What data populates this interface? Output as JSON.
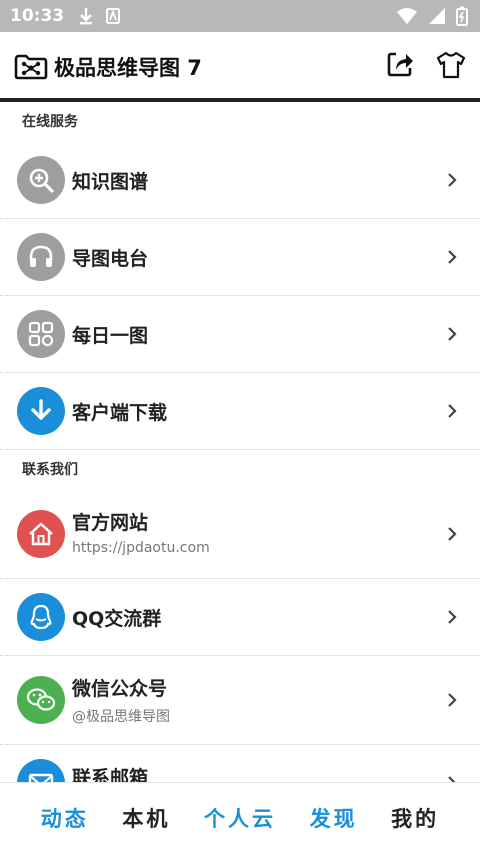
{
  "status_bar": {
    "time": "10:33"
  },
  "app_bar": {
    "title": "极品思维导图 7"
  },
  "sections": {
    "online": {
      "header": "在线服务",
      "items": [
        {
          "label": "知识图谱",
          "icon": "magnifier-plus-icon",
          "color": "#9e9e9e"
        },
        {
          "label": "导图电台",
          "icon": "headphones-icon",
          "color": "#9e9e9e"
        },
        {
          "label": "每日一图",
          "icon": "grid-apps-icon",
          "color": "#9e9e9e"
        },
        {
          "label": "客户端下载",
          "icon": "download-arrow-icon",
          "color": "#1a8ed8"
        }
      ]
    },
    "contact": {
      "header": "联系我们",
      "items": [
        {
          "label": "官方网站",
          "sub": "https://jpdaotu.com",
          "icon": "home-icon",
          "color": "#e05252"
        },
        {
          "label": "QQ交流群",
          "icon": "qq-penguin-icon",
          "color": "#1a8ed8"
        },
        {
          "label": "微信公众号",
          "sub": "@极品思维导图",
          "icon": "wechat-icon",
          "color": "#4caf50"
        },
        {
          "label": "联系邮箱",
          "icon": "mail-icon",
          "color": "#1a8ed8"
        }
      ]
    }
  },
  "bottom_nav": {
    "tabs": [
      {
        "label": "动态",
        "color": "#1a8ed8"
      },
      {
        "label": "本机",
        "color": "#222222"
      },
      {
        "label": "个人云",
        "color": "#1a8ed8"
      },
      {
        "label": "发现",
        "color": "#1a8ed8"
      },
      {
        "label": "我的",
        "color": "#222222"
      }
    ]
  }
}
